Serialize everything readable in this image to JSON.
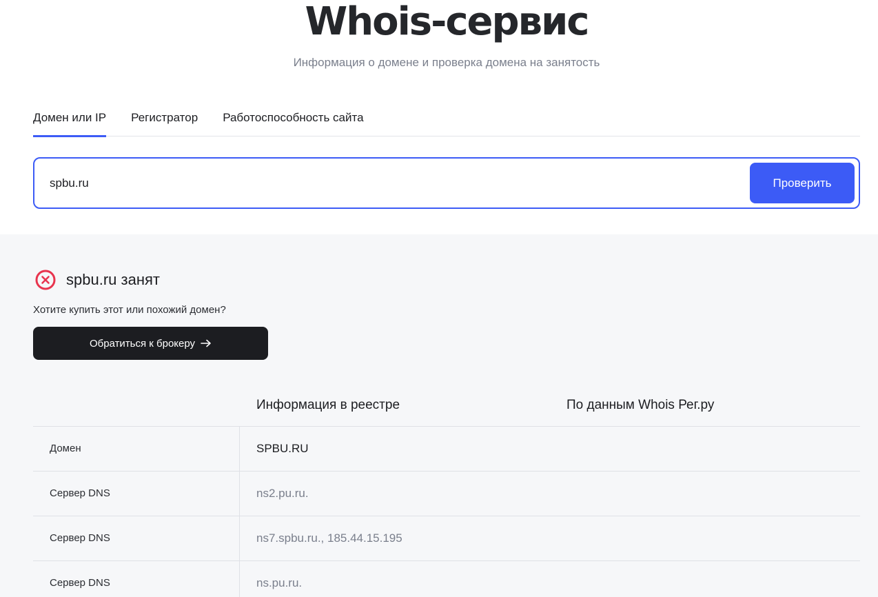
{
  "header": {
    "title": "Whois-сервис",
    "subtitle": "Информация о домене и проверка домена на занятость"
  },
  "tabs": [
    {
      "label": "Домен или IP",
      "active": true
    },
    {
      "label": "Регистратор",
      "active": false
    },
    {
      "label": "Работоспособность сайта",
      "active": false
    }
  ],
  "search": {
    "value": "spbu.ru",
    "button_label": "Проверить"
  },
  "result": {
    "status_icon": "x-circle-icon",
    "status_color": "#e8344e",
    "domain": "spbu.ru",
    "status_text": "занят",
    "buy_question": "Хотите купить этот или похожий домен?",
    "broker_button_label": "Обратиться к брокеру",
    "broker_button_icon": "arrow-right-icon"
  },
  "table": {
    "columns": [
      "",
      "Информация в реестре",
      "По данным Whois Рег.ру"
    ],
    "rows": [
      {
        "label": "Домен",
        "value": "SPBU.RU"
      },
      {
        "label": "Сервер DNS",
        "value": "ns2.pu.ru."
      },
      {
        "label": "Сервер DNS",
        "value": "ns7.spbu.ru., 185.44.15.195"
      },
      {
        "label": "Сервер DNS",
        "value": "ns.pu.ru."
      }
    ]
  },
  "colors": {
    "accent": "#3c5bf6",
    "dark_button": "#1c1d21",
    "results_background": "#f6f7f9"
  }
}
